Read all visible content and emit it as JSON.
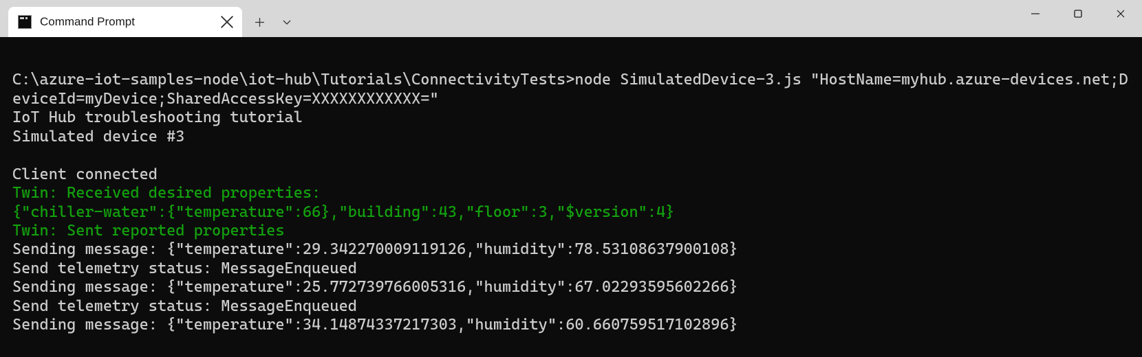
{
  "titlebar": {
    "tab_title": "Command Prompt"
  },
  "terminal": {
    "line_cmd": "C:\\azure-iot-samples-node\\iot-hub\\Tutorials\\ConnectivityTests>node SimulatedDevice-3.js \"HostName=myhub.azure-devices.net;DeviceId=myDevice;SharedAccessKey=XXXXXXXXXXXX=\"",
    "line_tutorial": "IoT Hub troubleshooting tutorial",
    "line_sim": "Simulated device #3",
    "line_connected": "Client connected",
    "line_twin_desired": "Twin: Received desired properties:",
    "line_twin_json": "{\"chiller-water\":{\"temperature\":66},\"building\":43,\"floor\":3,\"$version\":4}",
    "line_twin_sent": "Twin: Sent reported properties",
    "line_send1": "Sending message: {\"temperature\":29.342270009119126,\"humidity\":78.53108637900108}",
    "line_status1": "Send telemetry status: MessageEnqueued",
    "line_send2": "Sending message: {\"temperature\":25.772739766005316,\"humidity\":67.02293595602266}",
    "line_status2": "Send telemetry status: MessageEnqueued",
    "line_send3": "Sending message: {\"temperature\":34.14874337217303,\"humidity\":60.660759517102896}"
  }
}
